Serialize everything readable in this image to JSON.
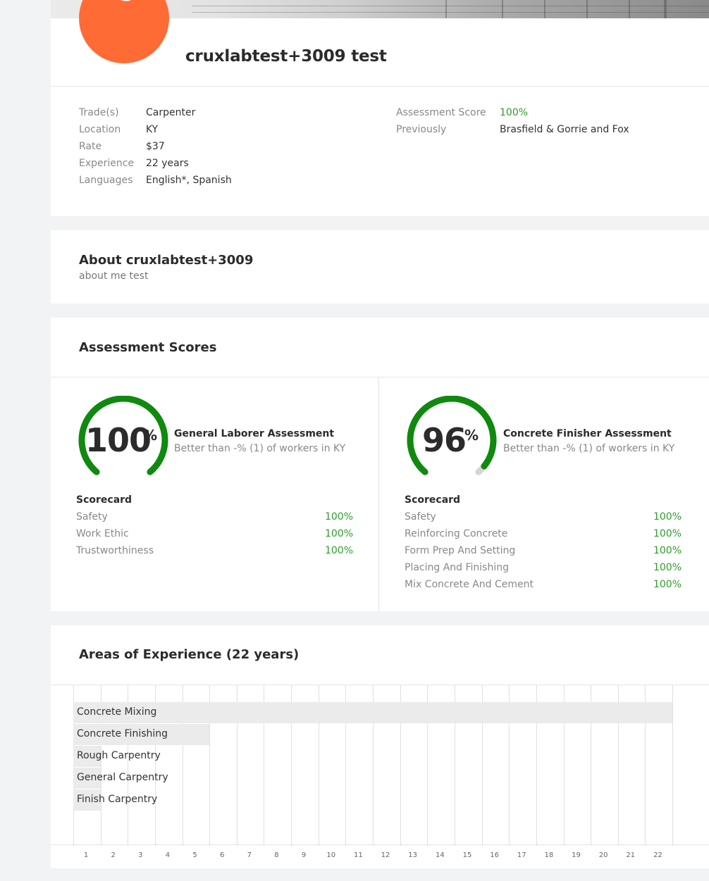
{
  "profile": {
    "avatar_initial": "C",
    "name": "cruxlabtest+3009 test"
  },
  "details": {
    "left": [
      {
        "label": "Trade(s)",
        "value": "Carpenter"
      },
      {
        "label": "Location",
        "value": "KY"
      },
      {
        "label": "Rate",
        "value": "$37"
      },
      {
        "label": "Experience",
        "value": "22 years"
      },
      {
        "label": "Languages",
        "value": "English*, Spanish"
      }
    ],
    "right": [
      {
        "label": "Assessment Score",
        "value": "100%"
      },
      {
        "label": "Previously",
        "value": "Brasfield & Gorrie and Fox"
      }
    ]
  },
  "about": {
    "title": "About cruxlabtest+3009",
    "text": "about me test"
  },
  "assessments": {
    "title": "Assessment Scores",
    "items": [
      {
        "score": "100",
        "score_fraction": 1.0,
        "pct_symbol": "%",
        "name": "General Laborer Assessment",
        "comparison": "Better than -% (1) of workers in KY",
        "scorecard_title": "Scorecard",
        "rows": [
          {
            "label": "Safety",
            "value": "100%"
          },
          {
            "label": "Work Ethic",
            "value": "100%"
          },
          {
            "label": "Trustworthiness",
            "value": "100%"
          }
        ]
      },
      {
        "score": "96",
        "score_fraction": 0.96,
        "pct_symbol": "%",
        "name": "Concrete Finisher Assessment",
        "comparison": "Better than -% (1) of workers in KY",
        "scorecard_title": "Scorecard",
        "rows": [
          {
            "label": "Safety",
            "value": "100%"
          },
          {
            "label": "Reinforcing Concrete",
            "value": "100%"
          },
          {
            "label": "Form Prep And Setting",
            "value": "100%"
          },
          {
            "label": "Placing And Finishing",
            "value": "100%"
          },
          {
            "label": "Mix Concrete And Cement",
            "value": "100%"
          }
        ]
      }
    ]
  },
  "experience": {
    "title": "Areas of Experience (22 years)",
    "areas": [
      {
        "label": "Concrete Mixing",
        "years": 22
      },
      {
        "label": "Concrete Finishing",
        "years": 5
      },
      {
        "label": "Rough Carpentry",
        "years": 1
      },
      {
        "label": "General Carpentry",
        "years": 1
      },
      {
        "label": "Finish Carpentry",
        "years": 1
      }
    ],
    "ticks": [
      "1",
      "2",
      "3",
      "4",
      "5",
      "6",
      "7",
      "8",
      "9",
      "10",
      "11",
      "12",
      "13",
      "14",
      "15",
      "16",
      "17",
      "18",
      "19",
      "20",
      "21",
      "22"
    ]
  },
  "colors": {
    "avatar": "#ff6b35",
    "gauge": "#0f8a0f",
    "score_green": "#2e9c2e",
    "bar": "#ebebeb"
  }
}
